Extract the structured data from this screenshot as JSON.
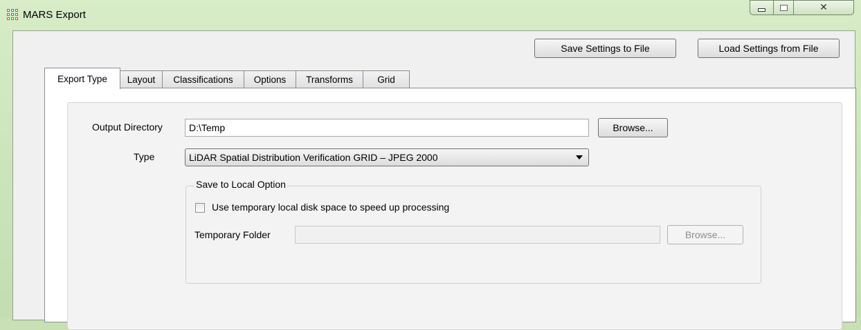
{
  "window": {
    "title": "MARS Export",
    "controls": {
      "minimize": "minimize-icon",
      "maximize": "maximize-icon",
      "close": "✕"
    }
  },
  "toolbar": {
    "save_settings": "Save Settings to File",
    "load_settings": "Load Settings from File"
  },
  "tabs": [
    {
      "label": "Export Type",
      "active": true
    },
    {
      "label": "Layout"
    },
    {
      "label": "Classifications"
    },
    {
      "label": "Options"
    },
    {
      "label": "Transforms"
    },
    {
      "label": "Grid"
    }
  ],
  "form": {
    "output_directory_label": "Output Directory",
    "output_directory_value": "D:\\Temp",
    "browse_label": "Browse...",
    "type_label": "Type",
    "type_value": "LiDAR Spatial Distribution Verification GRID – JPEG 2000"
  },
  "local_option": {
    "group_title": "Save to Local Option",
    "checkbox_label": "Use temporary local disk space to speed up processing",
    "checkbox_checked": false,
    "temp_folder_label": "Temporary Folder",
    "temp_folder_value": "",
    "browse_label": "Browse..."
  }
}
